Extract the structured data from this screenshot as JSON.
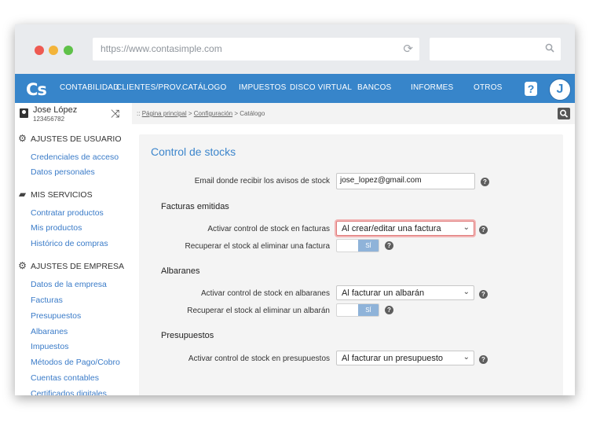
{
  "browser": {
    "url": "https://www.contasimple.com",
    "search_value": ""
  },
  "nav": {
    "logo": "Cs",
    "items": [
      "CONTABILIDAD",
      "CLIENTES/PROV.",
      "CATÁLOGO",
      "IMPUESTOS",
      "DISCO VIRTUAL",
      "BANCOS",
      "INFORMES",
      "OTROS"
    ],
    "help": "?",
    "avatar": "J"
  },
  "user": {
    "name": "Jose López",
    "id": "123456782"
  },
  "sidebar": {
    "sections": [
      {
        "title": "AJUSTES DE USUARIO",
        "icon": "gear-icon",
        "links": [
          "Credenciales de acceso",
          "Datos personales"
        ]
      },
      {
        "title": "MIS SERVICIOS",
        "icon": "briefcase-icon",
        "links": [
          "Contratar productos",
          "Mis productos",
          "Histórico de compras"
        ]
      },
      {
        "title": "AJUSTES DE EMPRESA",
        "icon": "gear-icon",
        "links": [
          "Datos de la empresa",
          "Facturas",
          "Presupuestos",
          "Albaranes",
          "Impuestos",
          "Métodos de Pago/Cobro",
          "Cuentas contables",
          "Certificados digitales"
        ]
      }
    ]
  },
  "breadcrumb": {
    "prefix": "::",
    "items": [
      "Página principal",
      "Configuración",
      "Catálogo"
    ],
    "separator": ">"
  },
  "main": {
    "title": "Control de stocks",
    "email_label": "Email donde recibir los avisos de stock",
    "email_value": "jose_lopez@gmail.com",
    "facturas": {
      "heading": "Facturas emitidas",
      "activar_label": "Activar control de stock en facturas",
      "activar_value": "Al crear/editar una factura",
      "recuperar_label": "Recuperar el stock al eliminar una factura",
      "recuperar_value": "SÍ"
    },
    "albaranes": {
      "heading": "Albaranes",
      "activar_label": "Activar control de stock en albaranes",
      "activar_value": "Al facturar un albarán",
      "recuperar_label": "Recuperar el stock al eliminar un albarán",
      "recuperar_value": "SÍ"
    },
    "presupuestos": {
      "heading": "Presupuestos",
      "activar_label": "Activar control de stock en presupuestos",
      "activar_value": "Al facturar un presupuesto"
    },
    "help_glyph": "?"
  },
  "colors": {
    "nav_blue": "#3785ca",
    "link_blue": "#3a7bc8",
    "highlight": "#e07b7b"
  }
}
